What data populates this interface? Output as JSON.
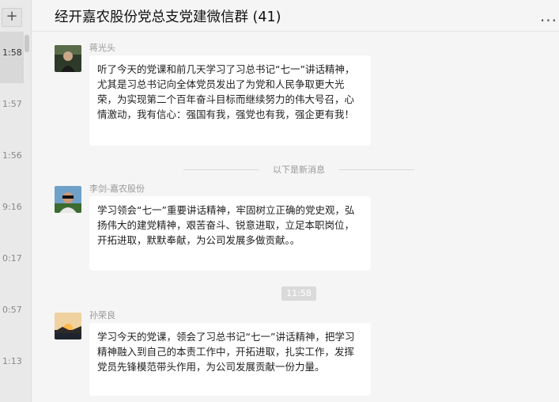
{
  "window": {
    "title": "经开嘉农股份党总支党建微信群 (41)",
    "more_label": "..."
  },
  "sidebar": {
    "add_label": "+",
    "times": [
      "1:58",
      "1:57",
      "1:56",
      "9:16",
      "0:17",
      "0:57",
      "1:13"
    ]
  },
  "messages": [
    {
      "sender": "蒋光头",
      "text": "听了今天的党课和前几天学习了习总书记“七一”讲话精神，尤其是习总书记向全体党员发出了为党和人民争取更大光荣，为实现第二个百年奋斗目标而继续努力的伟大号召，心情激动，我有信心：强国有我，强党也有我，强企更有我！"
    },
    {
      "sender": "李剑-嘉农股份",
      "text": "学习领会“七一”重要讲话精神，牢固树立正确的党史观，弘扬伟大的建党精神，艰苦奋斗、锐意进取，立足本职岗位，开拓进取，默默奉献，为公司发展多做贡献。。"
    },
    {
      "sender": "孙荣良",
      "text": "学习今天的党课，领会了习总书记“七一”讲话精神，把学习精神融入到自己的本责工作中，开拓进取，扎实工作，发挥党员先锋模范带头作用，为公司发展贡献一份力量。"
    }
  ],
  "divider_text": "以下是新消息",
  "time_stamp": "11:58",
  "colors": {
    "background": "#f5f5f5",
    "bubble": "#ffffff",
    "sidebar": "#e9e9e9"
  }
}
